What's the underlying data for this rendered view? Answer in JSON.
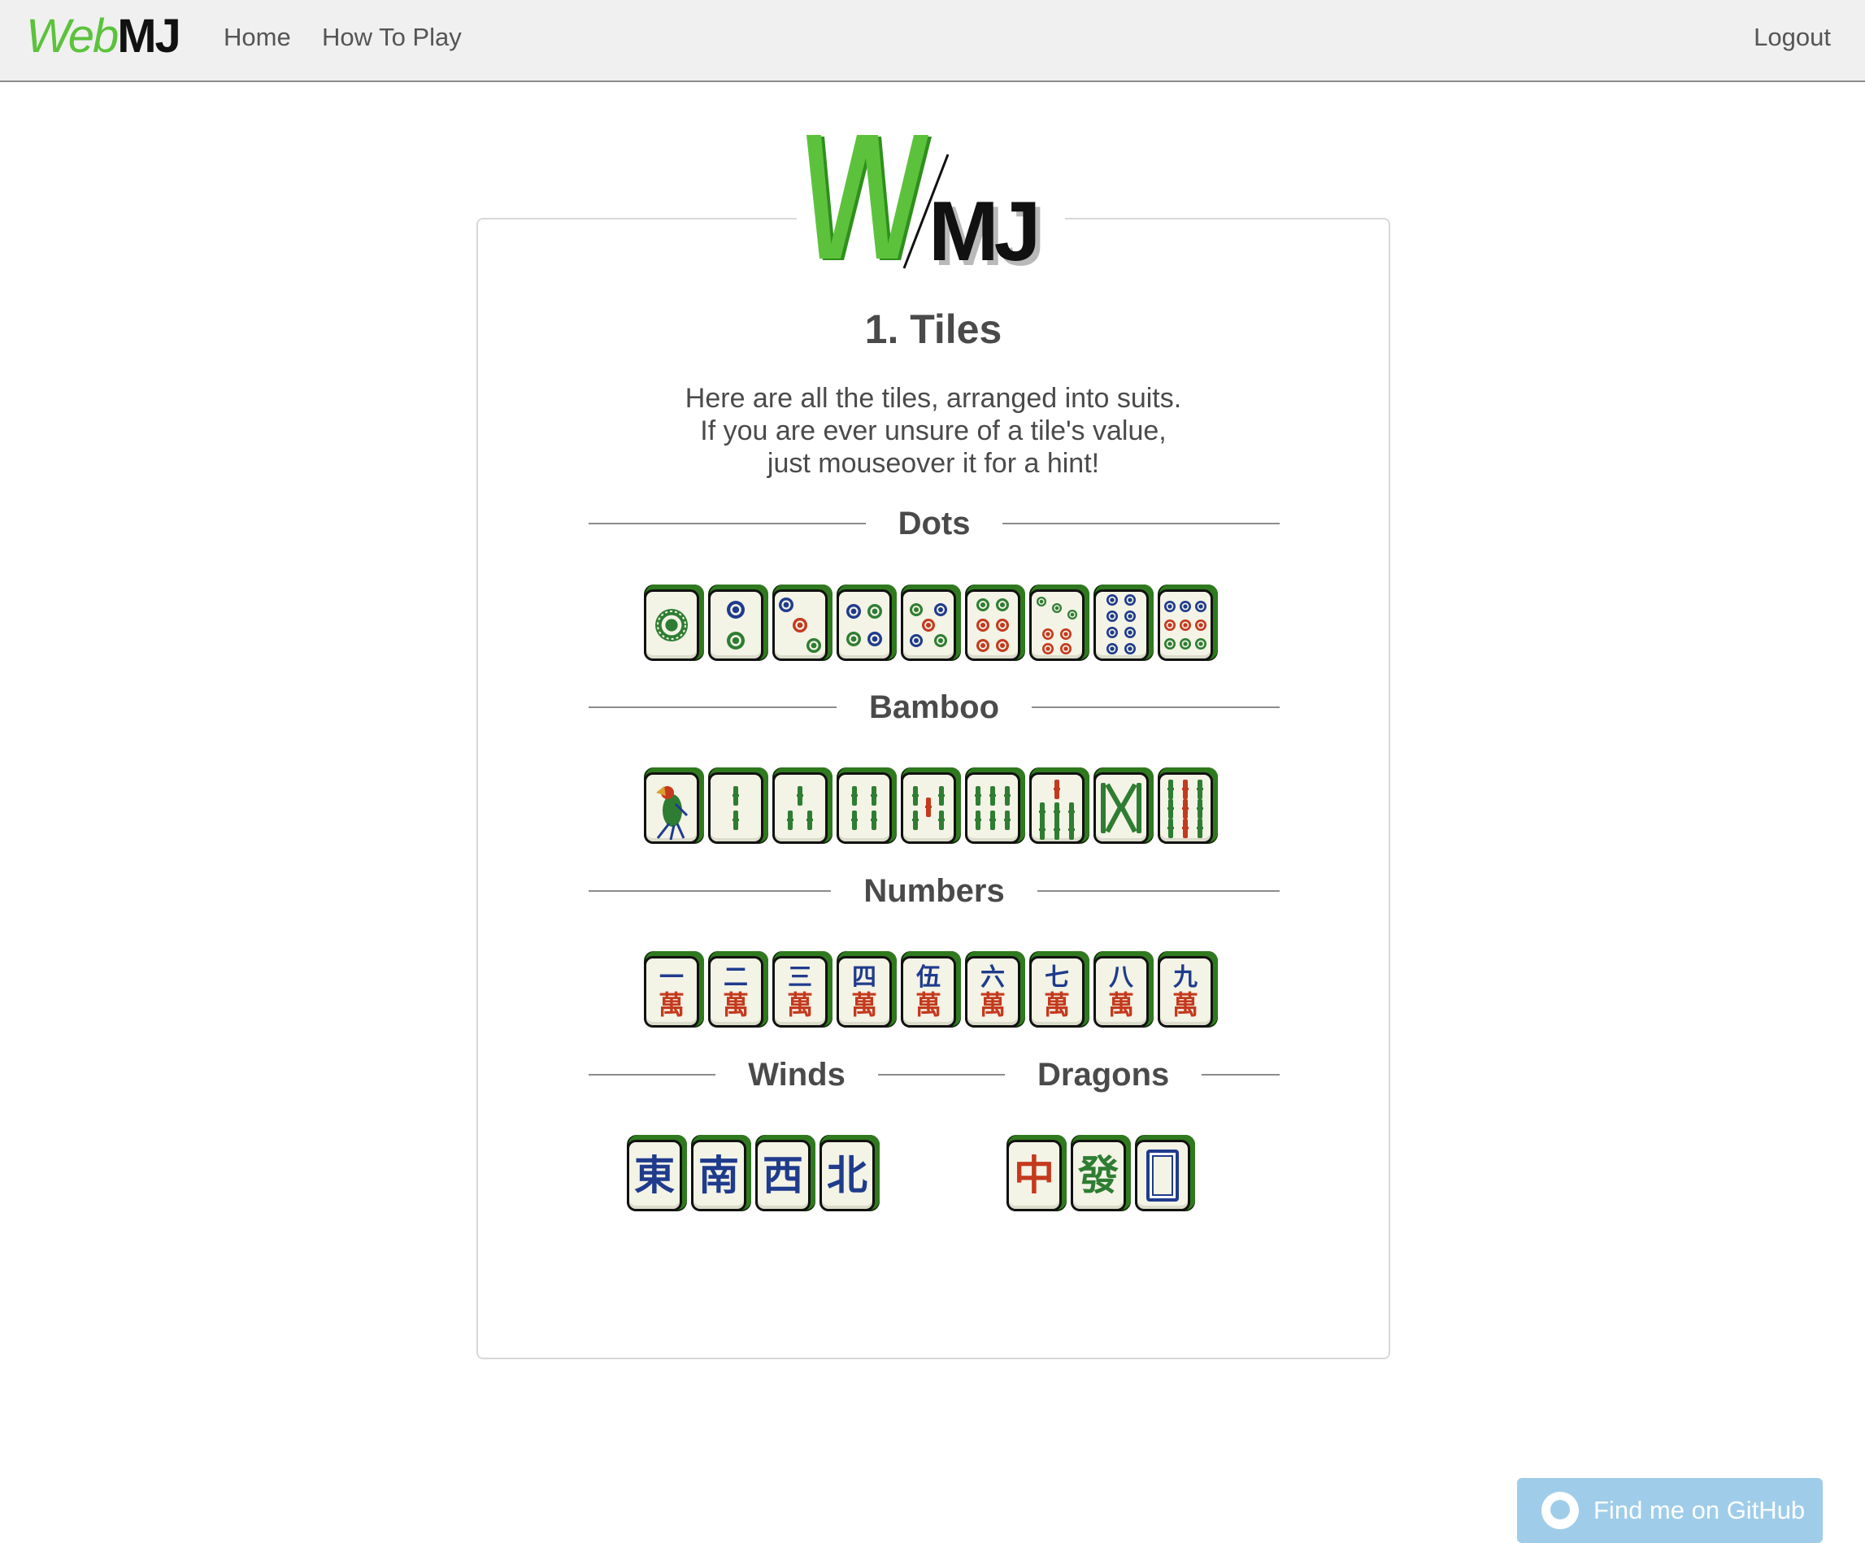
{
  "nav": {
    "brand_web": "Web",
    "brand_mj": "MJ",
    "home": "Home",
    "how_to_play": "How To Play",
    "logout": "Logout"
  },
  "main": {
    "logo_w": "W",
    "logo_mj": "MJ",
    "title": "1. Tiles",
    "intro": [
      "Here are all the tiles, arranged into suits.",
      "If you are ever unsure of a tile's value,",
      "just mouseover it for a hint!"
    ]
  },
  "sections": {
    "dots": "Dots",
    "bamboo": "Bamboo",
    "numbers": "Numbers",
    "winds": "Winds",
    "dragons": "Dragons"
  },
  "tiles": {
    "numbers": [
      {
        "top": "一",
        "bottom": "萬"
      },
      {
        "top": "二",
        "bottom": "萬"
      },
      {
        "top": "三",
        "bottom": "萬"
      },
      {
        "top": "四",
        "bottom": "萬"
      },
      {
        "top": "伍",
        "bottom": "萬"
      },
      {
        "top": "六",
        "bottom": "萬"
      },
      {
        "top": "七",
        "bottom": "萬"
      },
      {
        "top": "八",
        "bottom": "萬"
      },
      {
        "top": "九",
        "bottom": "萬"
      }
    ],
    "winds": [
      "東",
      "南",
      "西",
      "北"
    ],
    "dragons": [
      "中",
      "發"
    ]
  },
  "github": {
    "label": "Find me on GitHub"
  },
  "colors": {
    "brand_green": "#5cc23c",
    "tile_blue": "#1f3b8c",
    "tile_red": "#c43a1e",
    "tile_green": "#2e7d32",
    "github_button": "#9fcde9"
  }
}
